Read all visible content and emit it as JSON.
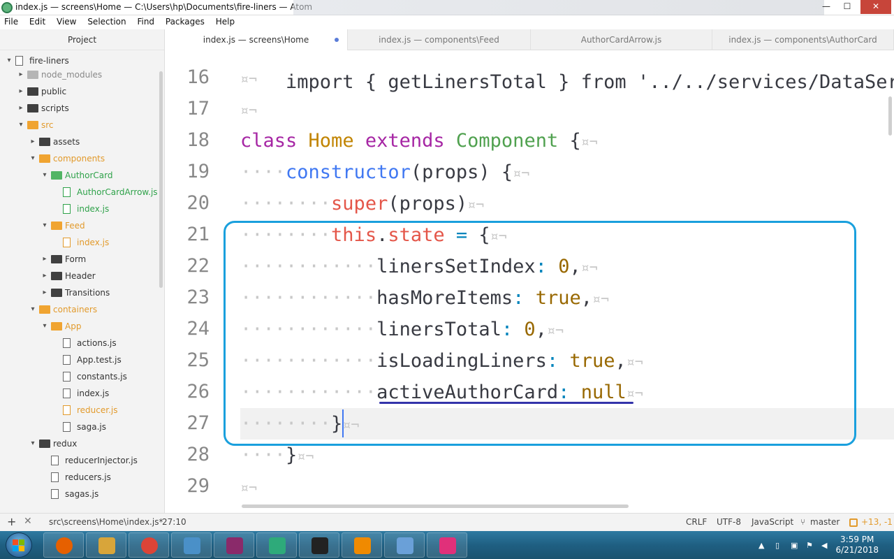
{
  "window": {
    "title": "index.js — screens\\Home — C:\\Users\\hp\\Documents\\fire-liners — Atom",
    "buttons": {
      "minimize": "—",
      "maximize": "☐",
      "close": "✕"
    }
  },
  "menu": [
    "File",
    "Edit",
    "View",
    "Selection",
    "Find",
    "Packages",
    "Help"
  ],
  "sidebar": {
    "header": "Project",
    "tree": [
      {
        "label": "fire-liners",
        "kind": "repo",
        "depth": 0,
        "expanded": true,
        "color": "dark"
      },
      {
        "label": "node_modules",
        "kind": "folder",
        "depth": 1,
        "expanded": false,
        "color": "gray"
      },
      {
        "label": "public",
        "kind": "folder",
        "depth": 1,
        "expanded": false,
        "color": "dark"
      },
      {
        "label": "scripts",
        "kind": "folder",
        "depth": 1,
        "expanded": false,
        "color": "dark"
      },
      {
        "label": "src",
        "kind": "folder",
        "depth": 1,
        "expanded": true,
        "color": "orange"
      },
      {
        "label": "assets",
        "kind": "folder",
        "depth": 2,
        "expanded": false,
        "color": "dark"
      },
      {
        "label": "components",
        "kind": "folder",
        "depth": 2,
        "expanded": true,
        "color": "orange"
      },
      {
        "label": "AuthorCard",
        "kind": "folder",
        "depth": 3,
        "expanded": true,
        "color": "green"
      },
      {
        "label": "AuthorCardArrow.js",
        "kind": "file",
        "depth": 4,
        "color": "green"
      },
      {
        "label": "index.js",
        "kind": "file",
        "depth": 4,
        "color": "green"
      },
      {
        "label": "Feed",
        "kind": "folder",
        "depth": 3,
        "expanded": true,
        "color": "orange"
      },
      {
        "label": "index.js",
        "kind": "file",
        "depth": 4,
        "color": "orange"
      },
      {
        "label": "Form",
        "kind": "folder",
        "depth": 3,
        "expanded": false,
        "color": "dark"
      },
      {
        "label": "Header",
        "kind": "folder",
        "depth": 3,
        "expanded": false,
        "color": "dark"
      },
      {
        "label": "Transitions",
        "kind": "folder",
        "depth": 3,
        "expanded": false,
        "color": "dark"
      },
      {
        "label": "containers",
        "kind": "folder",
        "depth": 2,
        "expanded": true,
        "color": "orange"
      },
      {
        "label": "App",
        "kind": "folder",
        "depth": 3,
        "expanded": true,
        "color": "orange"
      },
      {
        "label": "actions.js",
        "kind": "file",
        "depth": 4,
        "color": "dark"
      },
      {
        "label": "App.test.js",
        "kind": "file",
        "depth": 4,
        "color": "dark"
      },
      {
        "label": "constants.js",
        "kind": "file",
        "depth": 4,
        "color": "dark"
      },
      {
        "label": "index.js",
        "kind": "file",
        "depth": 4,
        "color": "dark"
      },
      {
        "label": "reducer.js",
        "kind": "file",
        "depth": 4,
        "color": "orange"
      },
      {
        "label": "saga.js",
        "kind": "file",
        "depth": 4,
        "color": "dark"
      },
      {
        "label": "redux",
        "kind": "folder",
        "depth": 2,
        "expanded": true,
        "color": "dark"
      },
      {
        "label": "reducerInjector.js",
        "kind": "file",
        "depth": 3,
        "color": "dark"
      },
      {
        "label": "reducers.js",
        "kind": "file",
        "depth": 3,
        "color": "dark"
      },
      {
        "label": "sagas.js",
        "kind": "file",
        "depth": 3,
        "color": "dark"
      }
    ]
  },
  "tabs": [
    {
      "label": "index.js — screens\\Home",
      "active": true,
      "modified": true
    },
    {
      "label": "index.js — components\\Feed",
      "active": false
    },
    {
      "label": "AuthorCardArrow.js",
      "active": false
    },
    {
      "label": "index.js — components\\AuthorCard",
      "active": false
    }
  ],
  "editor": {
    "first_line_partial": "import { getLinersTotal } from '../../services/DataServi",
    "lines": [
      {
        "num": "16",
        "indent": 0,
        "tokens": []
      },
      {
        "num": "17",
        "indent": 0,
        "tokens": []
      },
      {
        "num": "18",
        "indent": 0,
        "tokens": [
          [
            "kw",
            "class"
          ],
          [
            "sp",
            " "
          ],
          [
            "cls",
            "Home"
          ],
          [
            "sp",
            " "
          ],
          [
            "kw",
            "extends"
          ],
          [
            "sp",
            " "
          ],
          [
            "comp",
            "Component"
          ],
          [
            "sp",
            " "
          ],
          [
            "punc",
            "{"
          ]
        ]
      },
      {
        "num": "19",
        "indent": 1,
        "tokens": [
          [
            "fn",
            "constructor"
          ],
          [
            "punc",
            "(props) {"
          ]
        ]
      },
      {
        "num": "20",
        "indent": 2,
        "tokens": [
          [
            "super",
            "super"
          ],
          [
            "punc",
            "(props)"
          ]
        ]
      },
      {
        "num": "21",
        "indent": 2,
        "tokens": [
          [
            "this",
            "this"
          ],
          [
            "punc",
            "."
          ],
          [
            "this",
            "state"
          ],
          [
            "sp",
            " "
          ],
          [
            "op",
            "="
          ],
          [
            "sp",
            " "
          ],
          [
            "punc",
            "{"
          ]
        ]
      },
      {
        "num": "22",
        "indent": 3,
        "tokens": [
          [
            "prop",
            "linersSetIndex"
          ],
          [
            "op",
            ":"
          ],
          [
            "sp",
            " "
          ],
          [
            "num",
            "0"
          ],
          [
            "punc",
            ","
          ]
        ]
      },
      {
        "num": "23",
        "indent": 3,
        "tokens": [
          [
            "prop",
            "hasMoreItems"
          ],
          [
            "op",
            ":"
          ],
          [
            "sp",
            " "
          ],
          [
            "bool",
            "true"
          ],
          [
            "punc",
            ","
          ]
        ]
      },
      {
        "num": "24",
        "indent": 3,
        "tokens": [
          [
            "prop",
            "linersTotal"
          ],
          [
            "op",
            ":"
          ],
          [
            "sp",
            " "
          ],
          [
            "num",
            "0"
          ],
          [
            "punc",
            ","
          ]
        ]
      },
      {
        "num": "25",
        "indent": 3,
        "tokens": [
          [
            "prop",
            "isLoadingLiners"
          ],
          [
            "op",
            ":"
          ],
          [
            "sp",
            " "
          ],
          [
            "bool",
            "true"
          ],
          [
            "punc",
            ","
          ]
        ]
      },
      {
        "num": "26",
        "indent": 3,
        "tokens": [
          [
            "prop",
            "activeAuthorCard"
          ],
          [
            "op",
            ":"
          ],
          [
            "sp",
            " "
          ],
          [
            "bool",
            "null"
          ]
        ]
      },
      {
        "num": "27",
        "indent": 2,
        "tokens": [
          [
            "punc",
            "}"
          ]
        ]
      },
      {
        "num": "28",
        "indent": 1,
        "tokens": [
          [
            "punc",
            "}"
          ]
        ]
      },
      {
        "num": "29",
        "indent": 0,
        "tokens": []
      }
    ],
    "invisible_marker": "¤¬"
  },
  "status": {
    "path": "src\\screens\\Home\\index.js*",
    "cursor": "27:10",
    "line_ending": "CRLF",
    "encoding": "UTF-8",
    "grammar": "JavaScript",
    "branch": "master",
    "diff": "+13, -1"
  },
  "taskbar": {
    "apps": [
      "firefox-icon",
      "file-explorer-icon",
      "chrome-icon",
      "remote-desktop-icon",
      "winrar-icon",
      "atom-icon",
      "cmd-icon",
      "vlc-icon",
      "paint-icon",
      "app-icon"
    ],
    "time": "3:59 PM",
    "date": "6/21/2018"
  },
  "colors": {
    "accent": "#1aa0dd",
    "keyword": "#a626a4",
    "class": "#c18401",
    "component": "#50a14f",
    "function": "#4078f2",
    "this": "#e45649"
  }
}
